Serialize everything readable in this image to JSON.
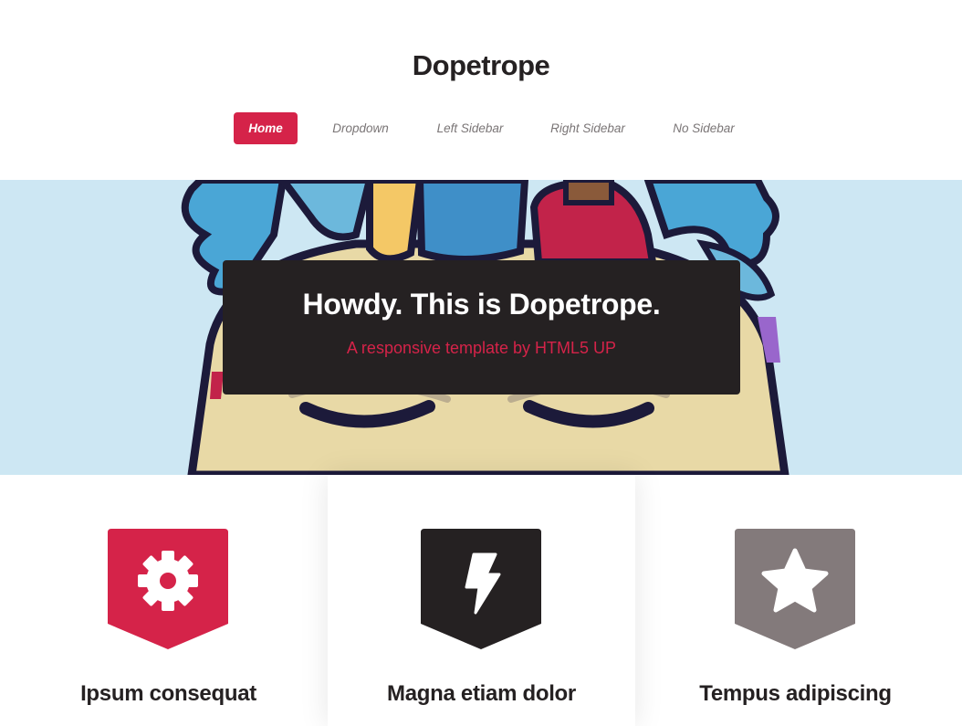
{
  "header": {
    "logo": "Dopetrope",
    "nav": [
      {
        "label": "Home",
        "active": true
      },
      {
        "label": "Dropdown",
        "active": false
      },
      {
        "label": "Left Sidebar",
        "active": false
      },
      {
        "label": "Right Sidebar",
        "active": false
      },
      {
        "label": "No Sidebar",
        "active": false
      }
    ]
  },
  "banner": {
    "title": "Howdy. This is Dopetrope.",
    "subtitle": "A responsive template by HTML5 UP"
  },
  "features": [
    {
      "title": "Ipsum consequat",
      "icon": "gear-icon",
      "color": "#d52349"
    },
    {
      "title": "Magna etiam dolor",
      "icon": "bolt-icon",
      "color": "#252122"
    },
    {
      "title": "Tempus adipiscing",
      "icon": "star-icon",
      "color": "#837a7b"
    }
  ],
  "colors": {
    "accent": "#d52349",
    "dark": "#252122",
    "banner_bg": "#cde7f3"
  }
}
